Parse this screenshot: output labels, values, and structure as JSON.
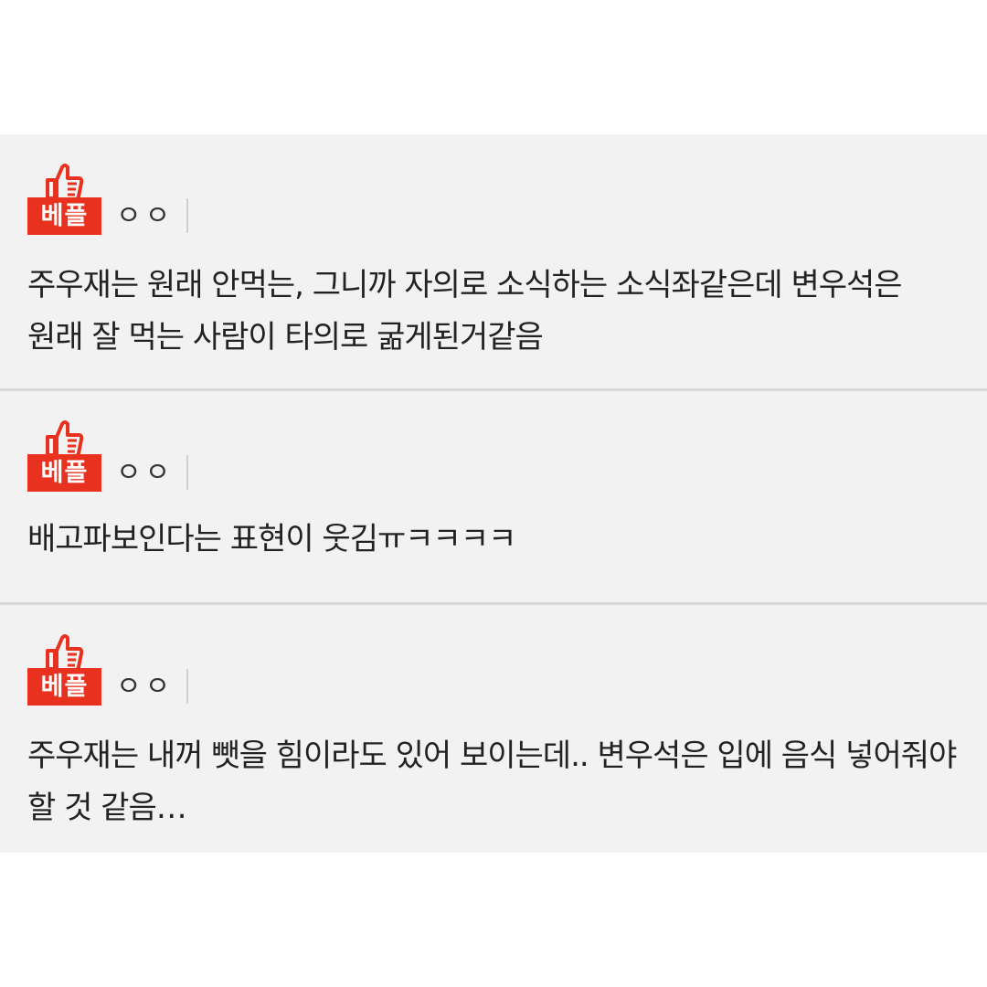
{
  "comments": [
    {
      "badge": "베플",
      "author": "ㅇㅇ",
      "text": "주우재는 원래 안먹는, 그니까 자의로 소식하는 소식좌같은데 변우석은 원래 잘 먹는 사람이 타의로 굶게된거같음"
    },
    {
      "badge": "베플",
      "author": "ㅇㅇ",
      "text": "배고파보인다는 표현이 웃김ㅠㅋㅋㅋㅋ"
    },
    {
      "badge": "베플",
      "author": "ㅇㅇ",
      "text": "주우재는 내꺼 뺏을 힘이라도 있어 보이는데.. 변우석은 입에 음식 넣어줘야 할 것 같음…"
    }
  ],
  "colors": {
    "badge": "#e8321f",
    "card_bg": "#f2f2f2",
    "separator": "#d9d9d9"
  },
  "icons": {
    "best_badge": "thumbs-up-icon"
  }
}
